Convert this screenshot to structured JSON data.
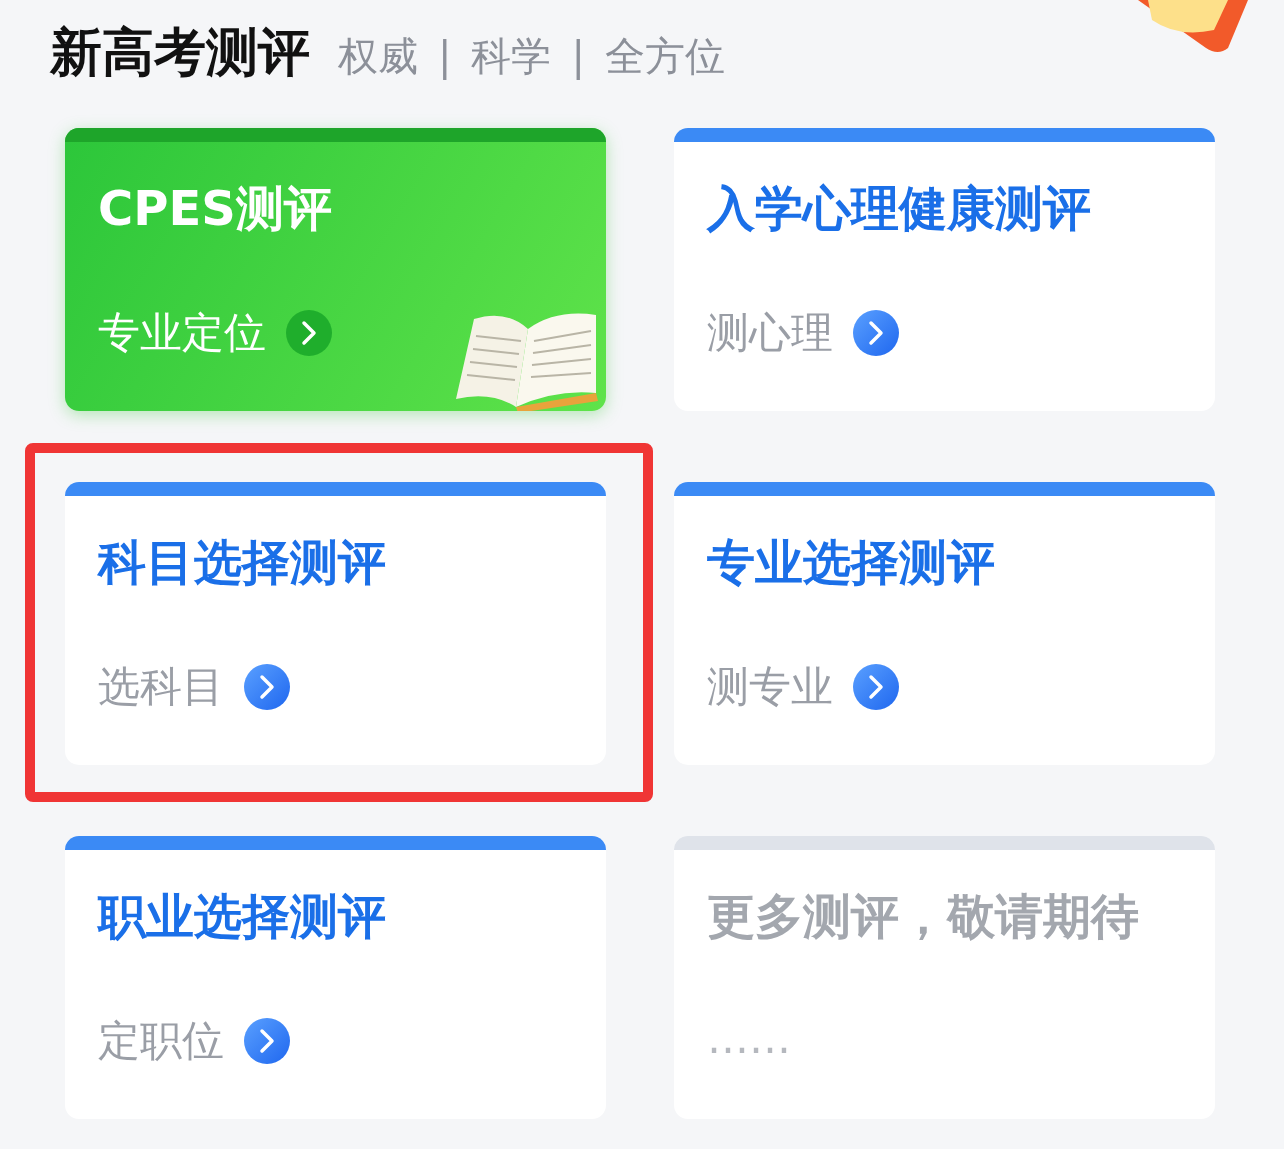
{
  "header": {
    "title": "新高考测评",
    "tags": [
      "权威",
      "|",
      "科学",
      "|",
      "全方位"
    ]
  },
  "cards": [
    {
      "kind": "green",
      "title": "CPES测评",
      "subtitle": "专业定位",
      "highlighted": false
    },
    {
      "kind": "blue",
      "title": "入学心理健康测评",
      "subtitle": "测心理",
      "highlighted": false
    },
    {
      "kind": "blue",
      "title": "科目选择测评",
      "subtitle": "选科目",
      "highlighted": true
    },
    {
      "kind": "blue",
      "title": "专业选择测评",
      "subtitle": "测专业",
      "highlighted": false
    },
    {
      "kind": "blue",
      "title": "职业选择测评",
      "subtitle": "定职位",
      "highlighted": false
    },
    {
      "kind": "disabled",
      "title": "更多测评，敬请期待",
      "subtitle": "……",
      "highlighted": false
    }
  ]
}
